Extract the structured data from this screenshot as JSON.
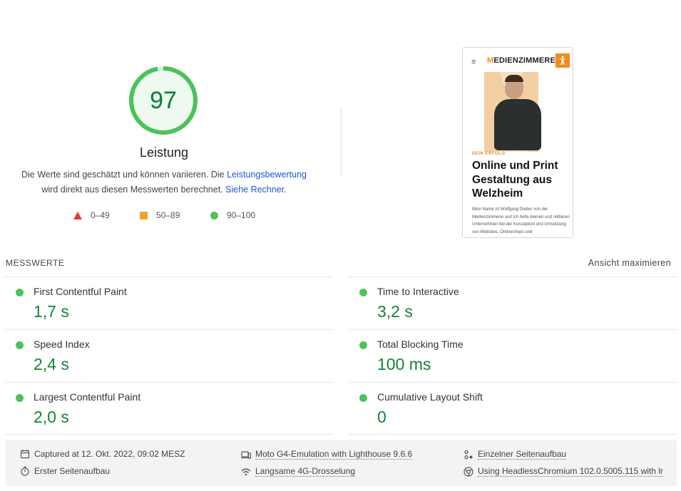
{
  "performance": {
    "score": "97",
    "score_fraction": 0.97,
    "title": "Leistung",
    "desc_part1": "Die Werte sind geschätzt und können variieren. Die ",
    "desc_link1": "Leistungsbewertung",
    "desc_part2": "wird direkt aus diesen Messwerten berechnet. ",
    "desc_link2": "Siehe Rechner",
    "desc_end": "."
  },
  "legend": [
    {
      "range": "0–49",
      "shape": "triangle",
      "color": "#e53935"
    },
    {
      "range": "50–89",
      "shape": "square",
      "color": "#f4a432"
    },
    {
      "range": "90–100",
      "shape": "circle",
      "color": "#4cc25a"
    }
  ],
  "screenshot": {
    "menu_glyph": "≡",
    "brand_first": "M",
    "brand_rest": "EDIENZIMMEREI",
    "kicker": "DEIN ERFOLG",
    "headline": "Online und Print Gestaltung aus Welzheim",
    "body": "Mein Name ist Wolfgang Dieber von der Medienzimmerei und ich helfe kleinen und mittleren Unternehmen bei der Konzeption und Umsetzung von Websites, Onlineshops und"
  },
  "metrics_section": {
    "header": "MESSWERTE",
    "toggle": "Ansicht maximieren"
  },
  "metrics_left": [
    {
      "title": "First Contentful Paint",
      "value": "1,7 s"
    },
    {
      "title": "Speed Index",
      "value": "2,4 s"
    },
    {
      "title": "Largest Contentful Paint",
      "value": "2,0 s"
    }
  ],
  "metrics_right": [
    {
      "title": "Time to Interactive",
      "value": "3,2 s"
    },
    {
      "title": "Total Blocking Time",
      "value": "100 ms"
    },
    {
      "title": "Cumulative Layout Shift",
      "value": "0"
    }
  ],
  "footer": {
    "captured": "Captured at 12. Okt. 2022, 09:02 MESZ",
    "first_load": "Erster Seitenaufbau",
    "device": "Moto G4-Emulation with Lighthouse 9.6.6",
    "throttling": "Langsame 4G-Drosselung",
    "single_load": "Einzelner Seitenaufbau",
    "browser": "Using HeadlessChromium 102.0.5005.115 with lr"
  },
  "colors": {
    "pass_green": "#0c7d35",
    "gauge_green": "#4cc25a",
    "link_blue": "#1a57d6"
  }
}
